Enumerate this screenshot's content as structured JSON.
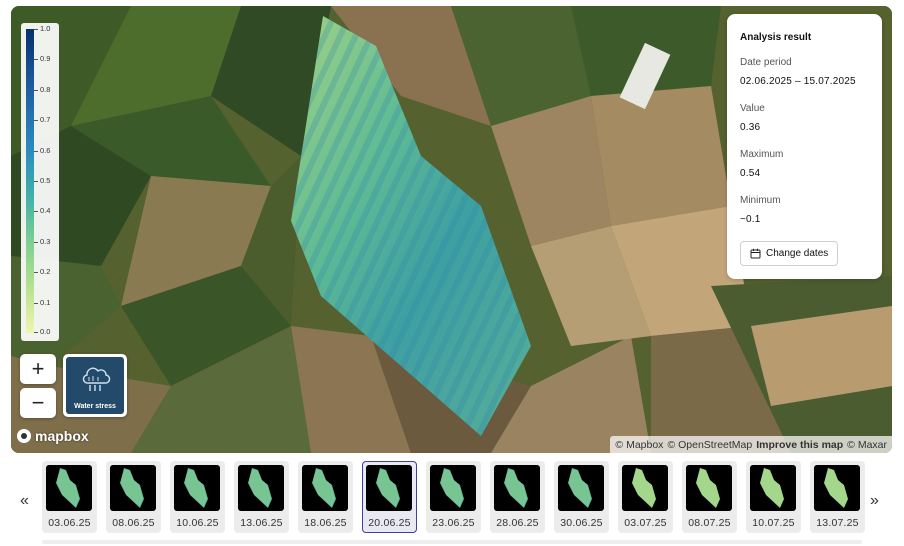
{
  "map": {
    "legend": {
      "labels": [
        "1.0",
        "0.9",
        "0.8",
        "0.7",
        "0.6",
        "0.5",
        "0.4",
        "0.3",
        "0.2",
        "0.1",
        "0.0"
      ]
    },
    "zoom_in_label": "+",
    "zoom_out_label": "−",
    "layer": {
      "label": "Water stress",
      "icon": "water-stress-icon"
    },
    "logo_text": "mapbox",
    "attribution": {
      "mapbox": "© Mapbox",
      "osm": "© OpenStreetMap",
      "improve": "Improve this map",
      "maxar": "© Maxar"
    }
  },
  "panel": {
    "title": "Analysis result",
    "date_period_label": "Date period",
    "date_period_value": "02.06.2025 – 15.07.2025",
    "value_label": "Value",
    "value": "0.36",
    "maximum_label": "Maximum",
    "maximum": "0.54",
    "minimum_label": "Minimum",
    "minimum": "−0.1",
    "change_dates_label": "Change dates",
    "change_dates_icon": "calendar-icon"
  },
  "timeline": {
    "prev_label": "«",
    "next_label": "»",
    "dates": [
      "03.06.25",
      "08.06.25",
      "10.06.25",
      "13.06.25",
      "18.06.25",
      "20.06.25",
      "23.06.25",
      "28.06.25",
      "30.06.25",
      "03.07.25",
      "08.07.25",
      "10.07.25",
      "13.07.25"
    ],
    "selected": "20.06.25"
  },
  "colors": {
    "accent_selected": "#3f3fa0",
    "field_low": "#b6e190",
    "field_high": "#2b8cbe"
  }
}
